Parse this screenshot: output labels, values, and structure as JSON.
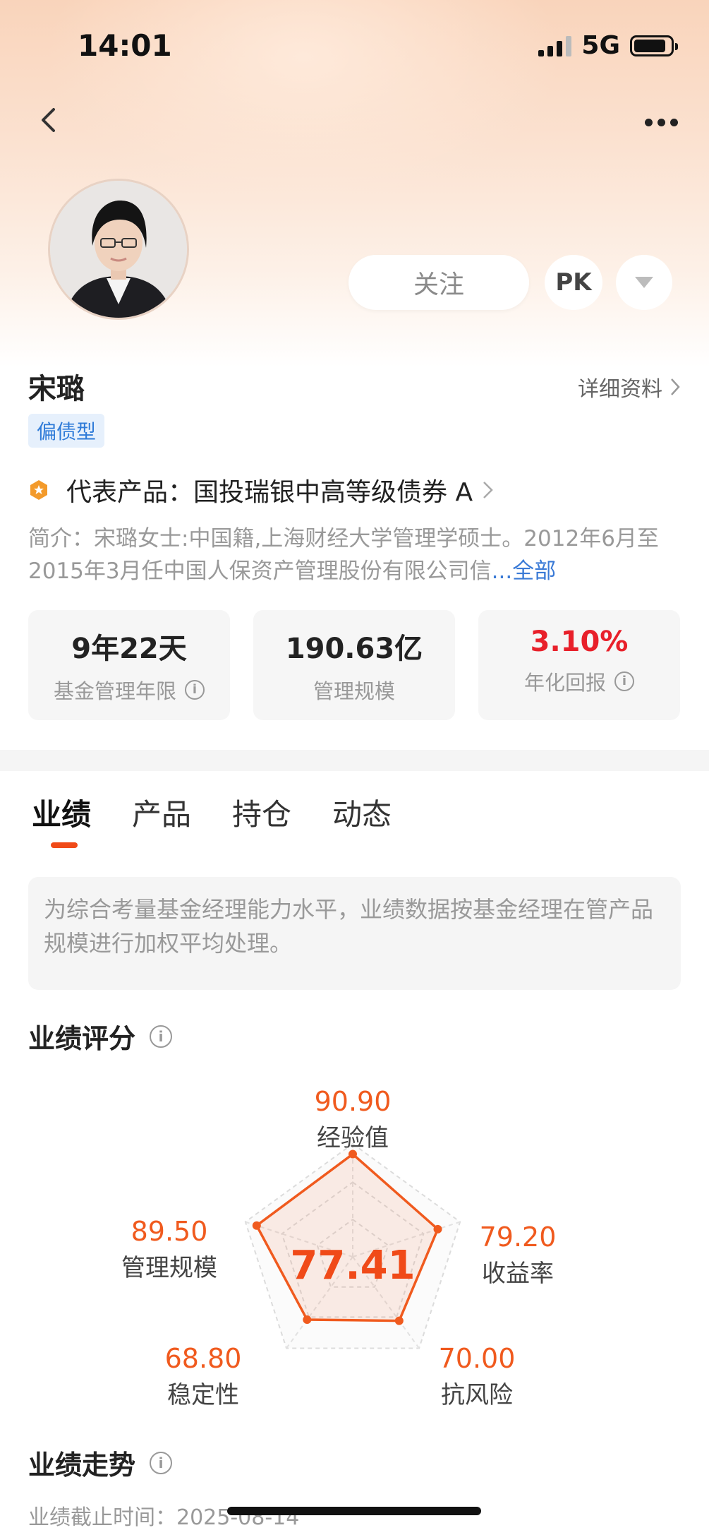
{
  "status_bar": {
    "time": "14:01",
    "network": "5G"
  },
  "header": {
    "follow_label": "关注",
    "pk_label": "PK"
  },
  "manager": {
    "name": "宋璐",
    "detail_link": "详细资料",
    "type_tag": "偏债型",
    "representative_product": "代表产品：国投瑞银中高等级债券 A",
    "intro": "简介：宋璐女士:中国籍,上海财经大学管理学硕士。2012年6月至2015年3月任中国人保资产管理股份有限公司信",
    "intro_more": "...全部"
  },
  "stats": [
    {
      "value": "9年22天",
      "label": "基金管理年限",
      "info": true
    },
    {
      "value": "190.63亿",
      "label": "管理规模",
      "info": false
    },
    {
      "value": "3.10%",
      "label": "年化回报",
      "info": true,
      "color": "#e8202a"
    }
  ],
  "tabs": [
    "业绩",
    "产品",
    "持仓",
    "动态"
  ],
  "active_tab": "业绩",
  "notice": "为综合考量基金经理能力水平，业绩数据按基金经理在管产品规模进行加权平均处理。",
  "score_section": {
    "title": "业绩评分",
    "total": "77.41",
    "dimensions": [
      {
        "label": "经验值",
        "value": "90.90",
        "score": 90.9
      },
      {
        "label": "收益率",
        "value": "79.20",
        "score": 79.2
      },
      {
        "label": "抗风险",
        "value": "70.00",
        "score": 70.0
      },
      {
        "label": "稳定性",
        "value": "68.80",
        "score": 68.8
      },
      {
        "label": "管理规模",
        "value": "89.50",
        "score": 89.5
      }
    ]
  },
  "trend_section": {
    "title": "业绩走势",
    "cutoff": "业绩截止时间：2025-08-14"
  },
  "colors": {
    "accent": "#f04a18",
    "positive": "#e8202a",
    "link": "#3a7ad6"
  }
}
